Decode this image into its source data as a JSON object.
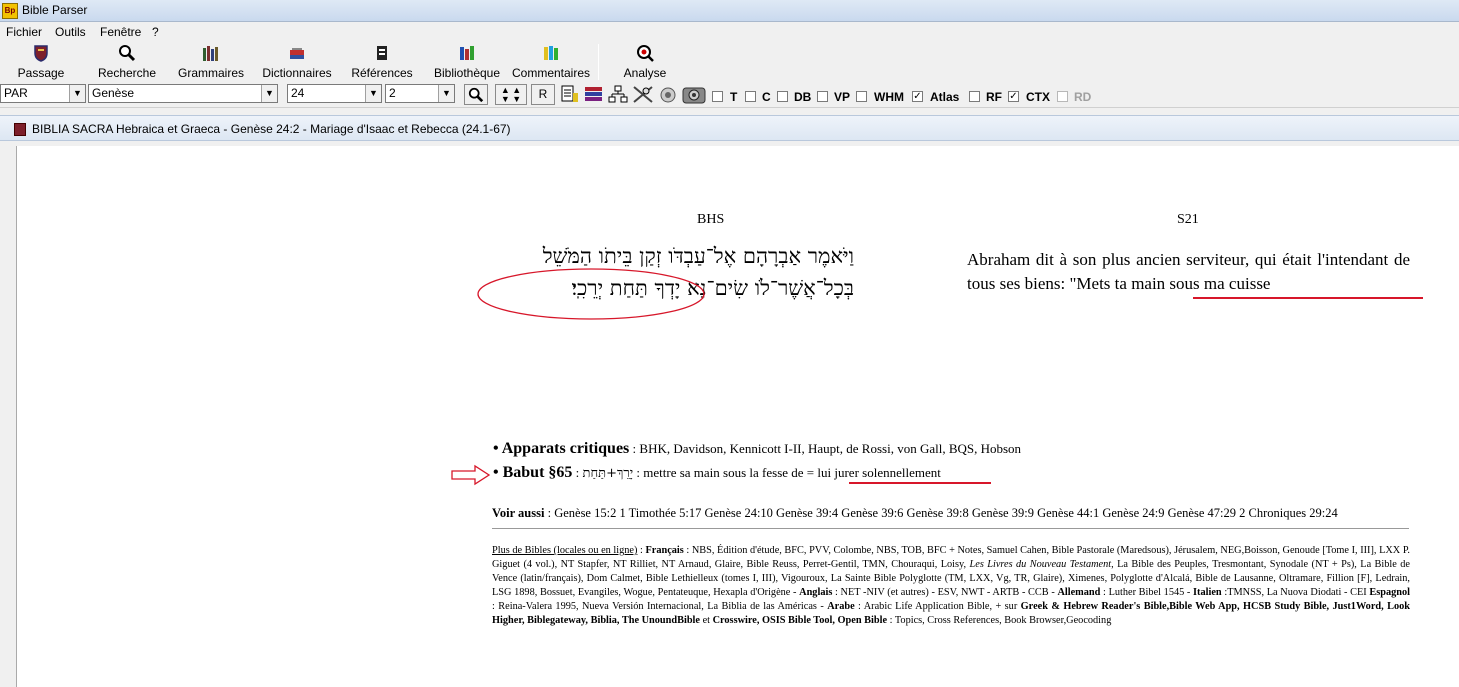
{
  "window": {
    "title": "Bible Parser",
    "icon_text": "Bp"
  },
  "menu": [
    "Fichier",
    "Outils",
    "Fenêtre",
    "?"
  ],
  "toolbar": {
    "buttons": [
      {
        "label": "Passage",
        "icon": "shield-icon"
      },
      {
        "label": "Recherche",
        "icon": "magnifier-icon"
      },
      {
        "label": "Grammaires",
        "icon": "books-icon"
      },
      {
        "label": "Dictionnaires",
        "icon": "dictionary-icon"
      },
      {
        "label": "Références",
        "icon": "book-icon"
      },
      {
        "label": "Bibliothèque",
        "icon": "library-icon"
      },
      {
        "label": "Commentaires",
        "icon": "colored-books-icon"
      },
      {
        "label": "Analyse",
        "icon": "analysis-icon"
      }
    ]
  },
  "options": {
    "version_select": "PAR",
    "book_select": "Genèse",
    "chapter_select": "24",
    "verse_select": "2",
    "r_button": "R",
    "checkboxes": [
      {
        "label": "T",
        "checked": false,
        "enabled": true
      },
      {
        "label": "C",
        "checked": false,
        "enabled": true
      },
      {
        "label": "DB",
        "checked": false,
        "enabled": true
      },
      {
        "label": "VP",
        "checked": false,
        "enabled": true
      },
      {
        "label": "WHM",
        "checked": false,
        "enabled": true
      },
      {
        "label": "Atlas",
        "checked": true,
        "enabled": true
      },
      {
        "label": "RF",
        "checked": false,
        "enabled": true
      },
      {
        "label": "CTX",
        "checked": true,
        "enabled": true
      },
      {
        "label": "RD",
        "checked": false,
        "enabled": false
      }
    ]
  },
  "document_window": {
    "title": "BIBLIA SACRA Hebraica et Graeca - Genèse 24:2 - Mariage d'Isaac et Rebecca (24.1-67)"
  },
  "passage": {
    "left_header": "BHS",
    "right_header": "S21",
    "hebrew_line1": "וַיֹּאמֶר אַבְרָהָם אֶל־עַבְדֹּו זְקַן בֵּיתֹו הַמֹּשֵׁל",
    "hebrew_line2": "בְּכָל־אֲשֶׁר־לֹו שִׂים־נָא יָדְךָ תַּחַת יְרֵכִֽי׃",
    "french_prefix": "Abraham dit à son plus ancien serviteur, qui était l'intendant de tous ses biens: ",
    "french_highlight": "\"Mets ta main sous ma cuisse"
  },
  "notes": {
    "apparats_label": "Apparats critiques",
    "apparats_text": " : BHK, Davidson, Kennicott I-II, Haupt, de Rossi, von Gall, BQS, Hobson",
    "babut_label": "Babut §65",
    "babut_hebrew": "יָרֵךְ+תַּחַת",
    "babut_text": " : mettre sa main sous la fesse de = ",
    "babut_highlight": "lui jurer solennellement"
  },
  "voir_aussi": {
    "label": "Voir aussi",
    "refs": " : Genèse 15:2 1 Timothée 5:17 Genèse 24:10 Genèse 39:4 Genèse 39:6 Genèse 39:8 Genèse 39:9 Genèse 44:1 Genèse 24:9 Genèse 47:29 2 Chroniques 29:24"
  },
  "more_bibles": {
    "link": "Plus de Bibles (locales ou en ligne)",
    "francais_label": "Français",
    "francais_text": " : NBS, Édition d'étude, BFC, PVV, Colombe, NBS, TOB, BFC + Notes, Samuel Cahen, Bible Pastorale (Maredsous), Jérusalem, NEG,Boisson, Genoude [Tome I, III], LXX P. Giguet (4 vol.), NT Stapfer, NT Rilliet, NT Arnaud, Glaire, Bible Reuss, Perret-Gentil, TMN, Chouraqui, Loisy, ",
    "francais_italic": "Les Livres du Nouveau Testament",
    "francais_text2": ", La Bible des Peuples, Tresmontant, Synodale (NT + Ps), La Bible de Vence (latin/français), Dom Calmet, Bible Lethielleux (tomes I, III), Vigouroux, La Sainte Bible Polyglotte (TM, LXX, Vg, TR, Glaire), Ximenes, Polyglotte d'Alcalá, Bible de Lausanne, Oltramare, Fillion [F], Ledrain, LSG 1898, Bossuet, Evangiles, Wogue, Pentateuque, Hexapla d'Origène - ",
    "anglais_label": "Anglais",
    "anglais_text": " : NET -NIV (et autres) - ESV, NWT - ARTB - CCB - ",
    "allemand_label": "Allemand",
    "allemand_text": " : Luther Bibel 1545 - ",
    "italien_label": "Italien",
    "italien_text": " :TMNSS, La Nuova Diodati - CEI ",
    "espagnol_label": "Espagnol",
    "espagnol_text": " : Reina-Valera 1995, Nueva Versión Internacional, La Biblia de las Américas - ",
    "arabe_label": "Arabe",
    "arabe_text": " : Arabic Life Application Bible, + sur ",
    "bold_tail": "Greek & Hebrew Reader's Bible,Bible Web App, HCSB Study Bible, Just1Word, Look Higher, Biblegateway, Biblia, The UnoundBible",
    "et": " et ",
    "bold_tail2": "Crosswire, OSIS Bible Tool, Open Bible",
    "end_text": " : Topics, Cross References, Book Browser,Geocoding"
  },
  "colors": {
    "annotation_red": "#d7172a"
  }
}
